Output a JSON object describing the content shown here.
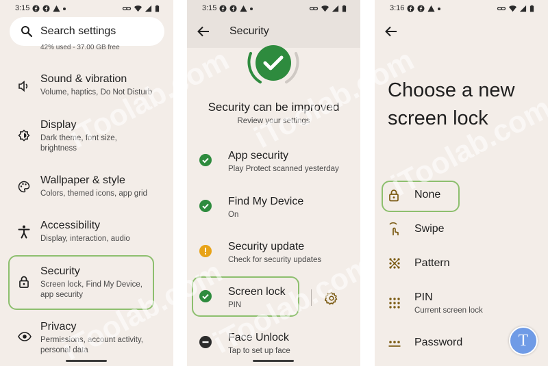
{
  "panel1": {
    "status": {
      "time": "3:15"
    },
    "search": {
      "placeholder": "Search settings"
    },
    "storage_fragment": "42% used - 37.00 GB free",
    "items": [
      {
        "title": "Sound & vibration",
        "subtitle": "Volume, haptics, Do Not Disturb",
        "icon": "volume-icon"
      },
      {
        "title": "Display",
        "subtitle": "Dark theme, font size, brightness",
        "icon": "brightness-icon"
      },
      {
        "title": "Wallpaper & style",
        "subtitle": "Colors, themed icons, app grid",
        "icon": "palette-icon"
      },
      {
        "title": "Accessibility",
        "subtitle": "Display, interaction, audio",
        "icon": "accessibility-icon"
      },
      {
        "title": "Security",
        "subtitle": "Screen lock, Find My Device, app security",
        "icon": "lock-icon"
      },
      {
        "title": "Privacy",
        "subtitle": "Permissions, account activity, personal data",
        "icon": "eye-icon"
      }
    ]
  },
  "panel2": {
    "status": {
      "time": "3:15"
    },
    "title": "Security",
    "heading": "Security can be improved",
    "subheading": "Review your settings",
    "items": [
      {
        "title": "App security",
        "subtitle": "Play Protect scanned yesterday",
        "icon": "check-circle-icon",
        "status": "ok"
      },
      {
        "title": "Find My Device",
        "subtitle": "On",
        "icon": "check-circle-icon",
        "status": "ok"
      },
      {
        "title": "Security update",
        "subtitle": "Check for security updates",
        "icon": "warning-circle-icon",
        "status": "warning"
      },
      {
        "title": "Screen lock",
        "subtitle": "PIN",
        "icon": "check-circle-icon",
        "status": "ok"
      },
      {
        "title": "Face Unlock",
        "subtitle": "Tap to set up face",
        "icon": "minus-circle-icon",
        "status": "off"
      }
    ]
  },
  "panel3": {
    "status": {
      "time": "3:16"
    },
    "heading": "Choose a new screen lock",
    "options": [
      {
        "title": "None",
        "subtitle": "",
        "icon": "lock-icon"
      },
      {
        "title": "Swipe",
        "subtitle": "",
        "icon": "swipe-icon"
      },
      {
        "title": "Pattern",
        "subtitle": "",
        "icon": "pattern-icon"
      },
      {
        "title": "PIN",
        "subtitle": "Current screen lock",
        "icon": "pin-icon"
      },
      {
        "title": "Password",
        "subtitle": "",
        "icon": "password-icon"
      }
    ]
  },
  "watermark": "iToolab.com",
  "logo_letter": "T",
  "colors": {
    "accent_green": "#2e8b3e",
    "highlight": "#8dbf6e",
    "warning": "#e8a317",
    "icon_gold": "#7a5a12",
    "background": "#f3ede8"
  }
}
